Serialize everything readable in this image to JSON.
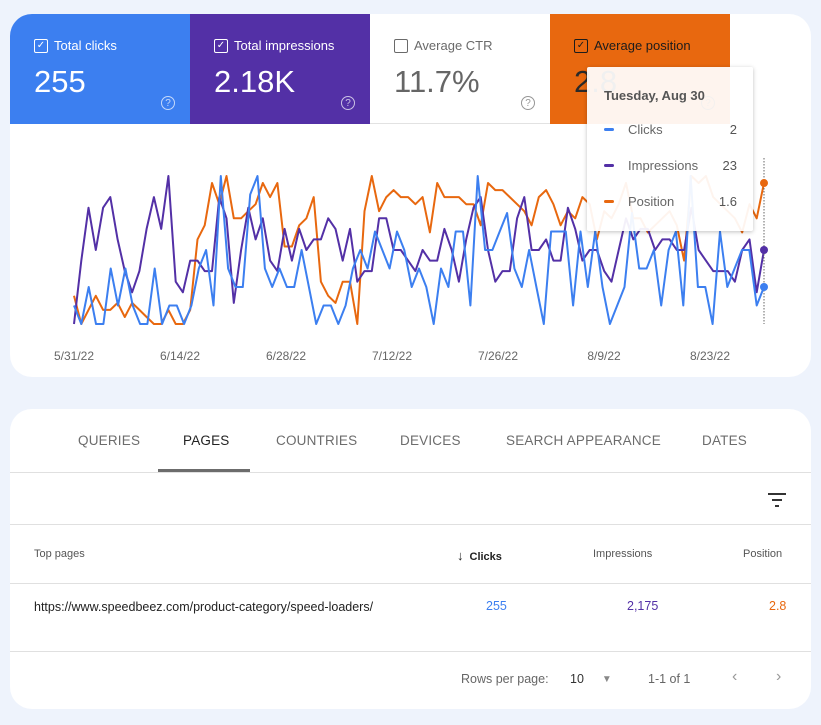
{
  "colors": {
    "clicks": "#3c7ff0",
    "impressions": "#5330a6",
    "position": "#e8680f"
  },
  "metrics": [
    {
      "key": "clicks",
      "label": "Total clicks",
      "value": "255",
      "checked": true
    },
    {
      "key": "impressions",
      "label": "Total impressions",
      "value": "2.18K",
      "checked": true
    },
    {
      "key": "ctr",
      "label": "Average CTR",
      "value": "11.7%",
      "checked": false
    },
    {
      "key": "position",
      "label": "Average position",
      "value": "2.8",
      "checked": true
    }
  ],
  "help_glyph": "?",
  "check_glyph": "✓",
  "tooltip": {
    "date": "Tuesday, Aug 30",
    "rows": [
      {
        "name": "Clicks",
        "value": "2"
      },
      {
        "name": "Impressions",
        "value": "23"
      },
      {
        "name": "Position",
        "value": "1.6"
      }
    ]
  },
  "chart_data": {
    "type": "line",
    "title": "",
    "x_tick_labels": [
      "5/31/22",
      "6/14/22",
      "6/28/22",
      "7/12/22",
      "7/26/22",
      "8/9/22",
      "8/23/22"
    ],
    "x_range": [
      "2022-05-31",
      "2022-08-30"
    ],
    "grid": false,
    "legend": "none",
    "series": [
      {
        "name": "Clicks",
        "scale": "independent",
        "values": [
          2,
          1,
          3,
          1,
          1,
          4,
          2,
          4,
          2,
          1,
          1,
          4,
          1,
          2,
          2,
          1,
          2,
          4,
          5,
          2,
          9,
          4,
          3,
          3,
          8,
          9,
          4,
          3,
          4,
          3,
          3,
          5,
          3,
          1,
          2,
          2,
          1,
          2,
          4,
          5,
          4,
          6,
          5,
          4,
          6,
          5,
          3,
          4,
          3,
          1,
          4,
          3,
          6,
          6,
          2,
          9,
          5,
          5,
          6,
          7,
          4,
          3,
          5,
          3,
          1,
          6,
          6,
          6,
          2,
          6,
          3,
          6,
          3,
          1,
          2,
          3,
          7,
          4,
          4,
          5,
          2,
          5,
          6,
          2,
          9,
          3,
          3,
          1,
          6,
          3,
          4,
          5,
          5,
          2,
          3
        ]
      },
      {
        "name": "Impressions",
        "scale": "independent",
        "values": [
          10,
          16,
          21,
          17,
          21,
          22,
          18,
          15,
          13,
          15,
          19,
          22,
          19,
          24,
          14,
          13,
          16,
          16,
          15,
          15,
          22,
          20,
          12,
          17,
          21,
          18,
          20,
          16,
          15,
          19,
          16,
          19,
          17,
          18,
          18,
          20,
          19,
          16,
          19,
          14,
          15,
          15,
          20,
          20,
          17,
          17,
          16,
          15,
          17,
          16,
          16,
          19,
          17,
          14,
          18,
          21,
          22,
          17,
          14,
          15,
          15,
          20,
          22,
          17,
          17,
          18,
          16,
          16,
          21,
          19,
          16,
          17,
          17,
          15,
          14,
          17,
          20,
          18,
          19,
          19,
          17,
          18,
          18,
          17,
          17,
          21,
          17,
          16,
          15,
          15,
          15,
          14,
          17,
          18,
          13,
          17
        ]
      },
      {
        "name": "Position",
        "scale": "independent_inverted",
        "values": [
          3.2,
          3.6,
          3.4,
          3.2,
          3.4,
          3.4,
          3.3,
          3.5,
          3.3,
          3.4,
          3.5,
          3.6,
          3.6,
          3.4,
          3.6,
          3.6,
          3.4,
          2.4,
          2.2,
          1.6,
          1.9,
          1.5,
          2.1,
          2.1,
          2.0,
          1.9,
          1.6,
          1.8,
          1.6,
          2.5,
          2.5,
          2.2,
          2.1,
          1.8,
          3.0,
          3.2,
          3.3,
          3.0,
          3.0,
          3.6,
          2.0,
          1.5,
          2.0,
          1.8,
          1.7,
          1.8,
          1.8,
          1.9,
          1.8,
          2.3,
          1.6,
          1.8,
          1.8,
          1.8,
          1.9,
          1.9,
          2.2,
          1.6,
          1.7,
          1.7,
          1.8,
          1.9,
          2.0,
          2.2,
          1.8,
          1.7,
          1.9,
          2.2,
          2.0,
          2.1,
          1.8,
          1.9,
          2.4,
          2.0,
          2.1,
          1.9,
          1.6,
          2.1,
          2.1,
          2.3,
          2.2,
          2.1,
          2.0,
          2.2,
          2.7,
          1.5,
          1.6,
          1.5,
          1.8,
          1.9,
          2.0,
          2.1,
          2.3,
          1.9,
          2.1,
          1.6
        ]
      }
    ],
    "hover_point": {
      "date": "Tuesday, Aug 30",
      "clicks": 2,
      "impressions": 23,
      "position": 1.6
    }
  },
  "tabs": [
    {
      "label": "QUERIES",
      "active": false
    },
    {
      "label": "PAGES",
      "active": true
    },
    {
      "label": "COUNTRIES",
      "active": false
    },
    {
      "label": "DEVICES",
      "active": false
    },
    {
      "label": "SEARCH APPEARANCE",
      "active": false
    },
    {
      "label": "DATES",
      "active": false
    }
  ],
  "table": {
    "columns": {
      "page": "Top pages",
      "clicks": "Clicks",
      "impressions": "Impressions",
      "position": "Position"
    },
    "sort_arrow": "↓",
    "rows": [
      {
        "page": "https://www.speedbeez.com/product-category/speed-loaders/",
        "clicks": "255",
        "impressions": "2,175",
        "position": "2.8"
      }
    ]
  },
  "pagination": {
    "rows_per_page_label": "Rows per page:",
    "rows_per_page_value": "10",
    "dropdown_glyph": "▼",
    "range": "1-1 of 1",
    "prev_glyph": "‹",
    "next_glyph": "›"
  }
}
